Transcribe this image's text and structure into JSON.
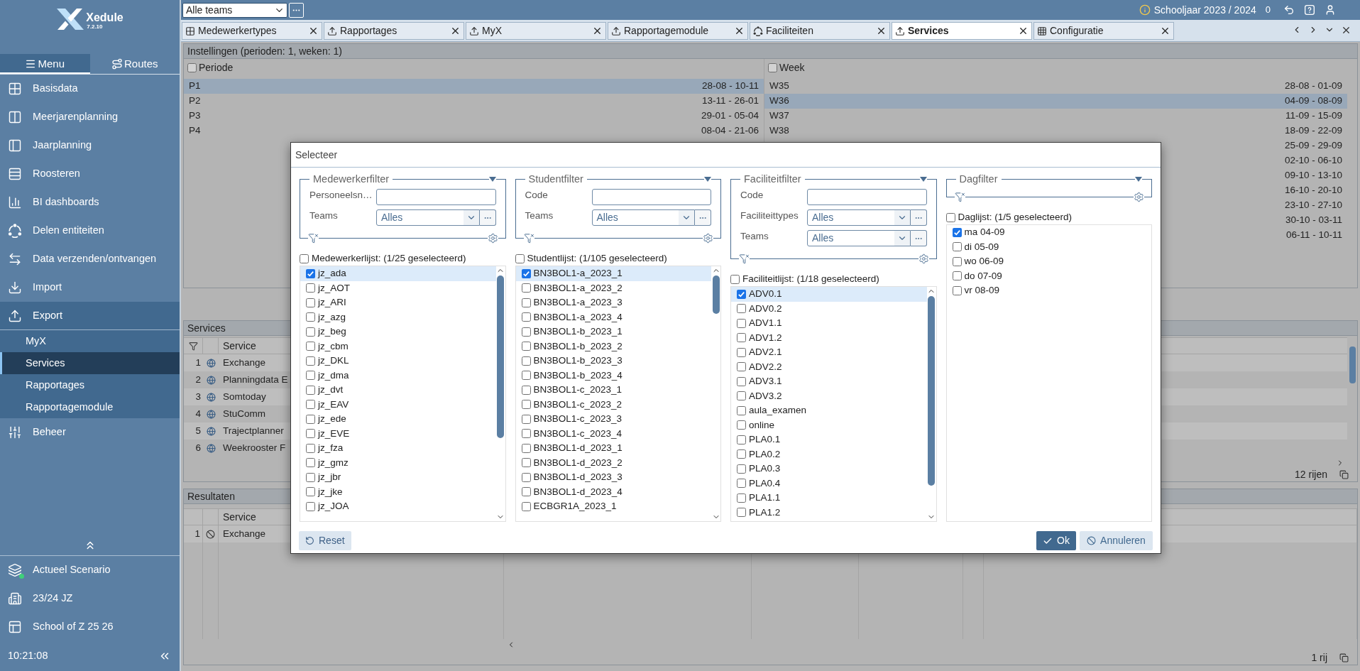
{
  "app": {
    "name": "Xedule",
    "version": "7.2.10"
  },
  "sidebar": {
    "tabs": [
      {
        "label": "Menu",
        "selected": true
      },
      {
        "label": "Routes",
        "selected": false
      }
    ],
    "items": [
      {
        "label": "Basisdata",
        "expanded": false
      },
      {
        "label": "Meerjarenplanning",
        "expanded": false
      },
      {
        "label": "Jaarplanning",
        "expanded": false
      },
      {
        "label": "Roosteren",
        "expanded": false
      },
      {
        "label": "BI dashboards",
        "expanded": false
      },
      {
        "label": "Delen entiteiten",
        "expanded": false
      },
      {
        "label": "Data verzenden/ontvangen",
        "expanded": false
      },
      {
        "label": "Import",
        "expanded": false
      },
      {
        "label": "Export",
        "expanded": true,
        "children": [
          {
            "label": "MyX",
            "selected": false
          },
          {
            "label": "Services",
            "selected": true
          },
          {
            "label": "Rapportages",
            "selected": false
          },
          {
            "label": "Rapportagemodule",
            "selected": false
          }
        ]
      },
      {
        "label": "Beheer",
        "expanded": false
      }
    ],
    "context": [
      {
        "label": "Actueel Scenario",
        "active": true
      },
      {
        "label": "23/24 JZ",
        "active": false
      },
      {
        "label": "School of Z 25 26",
        "active": false
      }
    ],
    "clock": "10:21:08"
  },
  "top_bar": {
    "team_select": {
      "value": "Alle teams"
    },
    "school_year": "Schooljaar 2023 / 2024",
    "notifications": "0"
  },
  "tabs": [
    {
      "label": "Medewerkertypes",
      "selected": false
    },
    {
      "label": "Rapportages",
      "selected": false
    },
    {
      "label": "MyX",
      "selected": false
    },
    {
      "label": "Rapportagemodule",
      "selected": false
    },
    {
      "label": "Faciliteiten",
      "selected": false
    },
    {
      "label": "Services",
      "selected": true
    },
    {
      "label": "Configuratie",
      "selected": false
    }
  ],
  "settings": {
    "title": "Instellingen (perioden: 1, weken: 1)",
    "periods": {
      "label": "Periode",
      "checked": false,
      "rows": [
        {
          "name": "P1",
          "dates": "28-08 - 10-11",
          "selected": true
        },
        {
          "name": "P2",
          "dates": "13-11 - 26-01",
          "selected": false
        },
        {
          "name": "P3",
          "dates": "29-01 - 05-04",
          "selected": false
        },
        {
          "name": "P4",
          "dates": "08-04 - 21-06",
          "selected": false
        }
      ]
    },
    "weeks": {
      "label": "Week",
      "checked": false,
      "rows": [
        {
          "name": "W35",
          "dates": "28-08 - 01-09",
          "selected": false
        },
        {
          "name": "W36",
          "dates": "04-09 - 08-09",
          "selected": true
        },
        {
          "name": "W37",
          "dates": "11-09 - 15-09",
          "selected": false
        },
        {
          "name": "W38",
          "dates": "18-09 - 22-09",
          "selected": false
        },
        {
          "dates": "25-09 - 29-09",
          "selected": false
        },
        {
          "dates": "02-10 - 06-10",
          "selected": false
        },
        {
          "dates": "09-10 - 13-10",
          "selected": false
        },
        {
          "dates": "16-10 - 20-10",
          "selected": false
        },
        {
          "dates": "23-10 - 27-10",
          "selected": false
        },
        {
          "dates": "30-10 - 03-11",
          "selected": false
        },
        {
          "dates": "06-11 - 10-11",
          "selected": false
        }
      ]
    }
  },
  "services": {
    "title": "Services",
    "columns": [
      "Service"
    ],
    "rows": [
      {
        "number": "1",
        "name": "Exchange"
      },
      {
        "number": "2",
        "name": "Planningdata E"
      },
      {
        "number": "3",
        "name": "Somtoday"
      },
      {
        "number": "4",
        "name": "StuComm"
      },
      {
        "number": "5",
        "name": "Trajectplanner"
      },
      {
        "number": "6",
        "name": "Weekrooster F"
      }
    ],
    "row_count": "12 rijen"
  },
  "results": {
    "title": "Resultaten",
    "columns": [
      "Service"
    ],
    "rows": [
      {
        "number": "1",
        "name": "Exchange"
      }
    ],
    "row_count": "1 rij"
  },
  "dialog": {
    "title": "Selecteer",
    "panels": [
      {
        "filter": {
          "title": "Medewerkerfilter",
          "fields": [
            {
              "kind": "text",
              "label": "Personeelsn…"
            },
            {
              "kind": "select",
              "label": "Teams",
              "value": "Alles"
            }
          ]
        },
        "list": {
          "label": "Medewerkerlijst: (1/25 geselecteerd)",
          "checked": false,
          "items": [
            {
              "label": "jz_ada",
              "checked": true,
              "selected": true
            },
            {
              "label": "jz_AOT",
              "checked": false,
              "selected": false
            },
            {
              "label": "jz_ARI",
              "checked": false,
              "selected": false
            },
            {
              "label": "jz_azg",
              "checked": false,
              "selected": false
            },
            {
              "label": "jz_beg",
              "checked": false,
              "selected": false
            },
            {
              "label": "jz_cbm",
              "checked": false,
              "selected": false
            },
            {
              "label": "jz_DKL",
              "checked": false,
              "selected": false
            },
            {
              "label": "jz_dma",
              "checked": false,
              "selected": false
            },
            {
              "label": "jz_dvt",
              "checked": false,
              "selected": false
            },
            {
              "label": "jz_EAV",
              "checked": false,
              "selected": false
            },
            {
              "label": "jz_ede",
              "checked": false,
              "selected": false
            },
            {
              "label": "jz_EVE",
              "checked": false,
              "selected": false
            },
            {
              "label": "jz_fza",
              "checked": false,
              "selected": false
            },
            {
              "label": "jz_gmz",
              "checked": false,
              "selected": false
            },
            {
              "label": "jz_jbr",
              "checked": false,
              "selected": false
            },
            {
              "label": "jz_jke",
              "checked": false,
              "selected": false
            },
            {
              "label": "jz_JOA",
              "checked": false,
              "selected": false
            }
          ]
        }
      },
      {
        "filter": {
          "title": "Studentfilter",
          "fields": [
            {
              "kind": "text",
              "label": "Code"
            },
            {
              "kind": "select",
              "label": "Teams",
              "value": "Alles"
            }
          ]
        },
        "list": {
          "label": "Studentlijst: (1/105 geselecteerd)",
          "checked": false,
          "items": [
            {
              "label": "BN3BOL1-a_2023_1",
              "checked": true,
              "selected": true
            },
            {
              "label": "BN3BOL1-a_2023_2",
              "checked": false,
              "selected": false
            },
            {
              "label": "BN3BOL1-a_2023_3",
              "checked": false,
              "selected": false
            },
            {
              "label": "BN3BOL1-a_2023_4",
              "checked": false,
              "selected": false
            },
            {
              "label": "BN3BOL1-b_2023_1",
              "checked": false,
              "selected": false
            },
            {
              "label": "BN3BOL1-b_2023_2",
              "checked": false,
              "selected": false
            },
            {
              "label": "BN3BOL1-b_2023_3",
              "checked": false,
              "selected": false
            },
            {
              "label": "BN3BOL1-b_2023_4",
              "checked": false,
              "selected": false
            },
            {
              "label": "BN3BOL1-c_2023_1",
              "checked": false,
              "selected": false
            },
            {
              "label": "BN3BOL1-c_2023_2",
              "checked": false,
              "selected": false
            },
            {
              "label": "BN3BOL1-c_2023_3",
              "checked": false,
              "selected": false
            },
            {
              "label": "BN3BOL1-c_2023_4",
              "checked": false,
              "selected": false
            },
            {
              "label": "BN3BOL1-d_2023_1",
              "checked": false,
              "selected": false
            },
            {
              "label": "BN3BOL1-d_2023_2",
              "checked": false,
              "selected": false
            },
            {
              "label": "BN3BOL1-d_2023_3",
              "checked": false,
              "selected": false
            },
            {
              "label": "BN3BOL1-d_2023_4",
              "checked": false,
              "selected": false
            },
            {
              "label": "ECBGR1A_2023_1",
              "checked": false,
              "selected": false
            }
          ]
        }
      },
      {
        "filter": {
          "title": "Faciliteitfilter",
          "fields": [
            {
              "kind": "text",
              "label": "Code"
            },
            {
              "kind": "select",
              "label": "Faciliteittypes",
              "value": "Alles"
            },
            {
              "kind": "select",
              "label": "Teams",
              "value": "Alles"
            }
          ]
        },
        "list": {
          "label": "Faciliteitlijst: (1/18 geselecteerd)",
          "checked": false,
          "items": [
            {
              "label": "ADV0.1",
              "checked": true,
              "selected": true
            },
            {
              "label": "ADV0.2",
              "checked": false,
              "selected": false
            },
            {
              "label": "ADV1.1",
              "checked": false,
              "selected": false
            },
            {
              "label": "ADV1.2",
              "checked": false,
              "selected": false
            },
            {
              "label": "ADV2.1",
              "checked": false,
              "selected": false
            },
            {
              "label": "ADV2.2",
              "checked": false,
              "selected": false
            },
            {
              "label": "ADV3.1",
              "checked": false,
              "selected": false
            },
            {
              "label": "ADV3.2",
              "checked": false,
              "selected": false
            },
            {
              "label": "aula_examen",
              "checked": false,
              "selected": false
            },
            {
              "label": "online",
              "checked": false,
              "selected": false
            },
            {
              "label": "PLA0.1",
              "checked": false,
              "selected": false
            },
            {
              "label": "PLA0.2",
              "checked": false,
              "selected": false
            },
            {
              "label": "PLA0.3",
              "checked": false,
              "selected": false
            },
            {
              "label": "PLA0.4",
              "checked": false,
              "selected": false
            },
            {
              "label": "PLA1.1",
              "checked": false,
              "selected": false
            },
            {
              "label": "PLA1.2",
              "checked": false,
              "selected": false
            }
          ]
        }
      },
      {
        "filter": {
          "title": "Dagfilter"
        },
        "list": {
          "label": "Daglijst: (1/5 geselecteerd)",
          "checked": false,
          "items": [
            {
              "label": "ma 04-09",
              "checked": true,
              "selected": false
            },
            {
              "label": "di 05-09",
              "checked": false,
              "selected": false
            },
            {
              "label": "wo 06-09",
              "checked": false,
              "selected": false
            },
            {
              "label": "do 07-09",
              "checked": false,
              "selected": false
            },
            {
              "label": "vr 08-09",
              "checked": false,
              "selected": false
            }
          ]
        }
      }
    ],
    "buttons": {
      "reset": "Reset",
      "ok": "Ok",
      "cancel": "Annuleren"
    }
  }
}
